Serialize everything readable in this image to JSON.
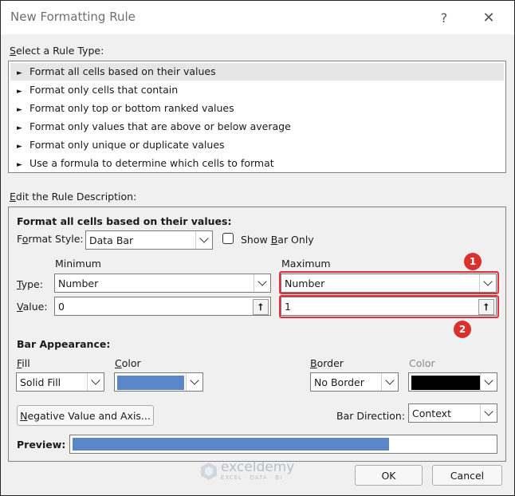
{
  "window": {
    "title": "New Formatting Rule",
    "help": "?",
    "close": "✕"
  },
  "rule_type": {
    "heading": "Select a Rule Type:",
    "items": [
      "Format all cells based on their values",
      "Format only cells that contain",
      "Format only top or bottom ranked values",
      "Format only values that are above or below average",
      "Format only unique or duplicate values",
      "Use a formula to determine which cells to format"
    ]
  },
  "edit": {
    "heading": "Edit the Rule Description:",
    "subheading": "Format all cells based on their values:",
    "format_style_label": "Format Style:",
    "format_style_value": "Data Bar",
    "show_bar_only": "Show Bar Only",
    "minimum_label": "Minimum",
    "maximum_label": "Maximum",
    "type_label": "Type:",
    "value_label": "Value:",
    "min_type": "Number",
    "max_type": "Number",
    "min_value": "0",
    "max_value": "1",
    "bar_appearance": "Bar Appearance:",
    "fill_label": "Fill",
    "fill_value": "Solid Fill",
    "color_label": "Color",
    "border_label": "Border",
    "border_value": "No Border",
    "border_color_label": "Color",
    "negative_button": "Negative Value and Axis...",
    "bar_direction_label": "Bar Direction:",
    "bar_direction_value": "Context",
    "preview_label": "Preview:",
    "preview_fill_fraction": 0.75
  },
  "colors": {
    "bar_color": "#5b87c8",
    "border_color": "#000000",
    "highlight": "#e0303c"
  },
  "badges": [
    "1",
    "2"
  ],
  "buttons": {
    "ok": "OK",
    "cancel": "Cancel"
  },
  "watermark": {
    "name": "exceldemy",
    "tagline": "EXCEL · DATA · BI"
  }
}
